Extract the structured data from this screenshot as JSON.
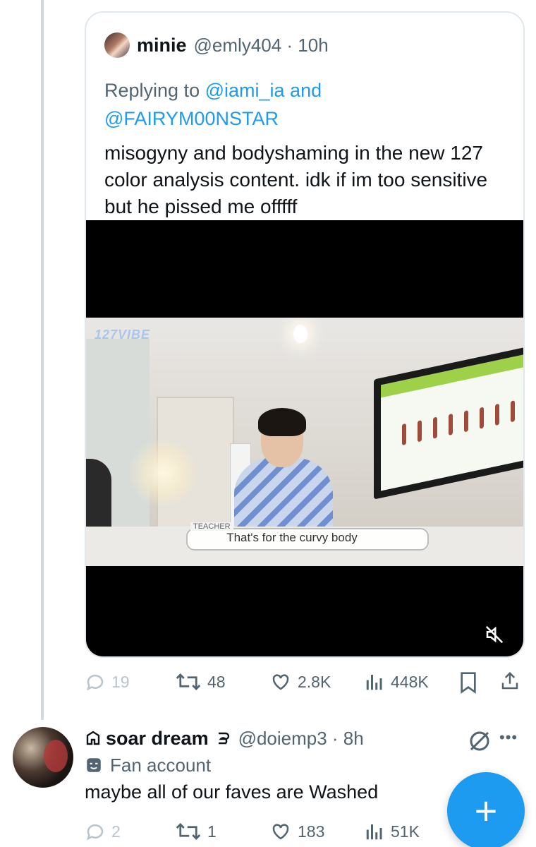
{
  "quote": {
    "name": "minie",
    "handle_time": "@emly404 · 10h",
    "reply_prefix": "Replying to ",
    "mention1": "@iami_ia",
    "reply_and": " and",
    "mention2": "@FAIRYM00NSTAR",
    "text": "misogyny and bodyshaming in the new 127 color analysis content. idk if im too sensitive but he pissed me offfff",
    "video": {
      "logo": "127VIBE",
      "caption_tag": "TEACHER",
      "caption": "That's for the curvy body"
    },
    "actions": {
      "replies": "19",
      "reposts": "48",
      "likes": "2.8K",
      "views": "448K"
    }
  },
  "post": {
    "name": "soar dream",
    "name_prefix_icon": "community-icon",
    "handle_time": "@doiemp3 · 8h",
    "label": "Fan account",
    "text": "maybe all of our faves are Washed",
    "actions": {
      "replies": "2",
      "reposts": "1",
      "likes": "183",
      "views": "51K"
    }
  },
  "fab_label": "+",
  "colors": {
    "accent": "#1d9bf0",
    "text": "#0f1419",
    "muted": "#536471"
  }
}
